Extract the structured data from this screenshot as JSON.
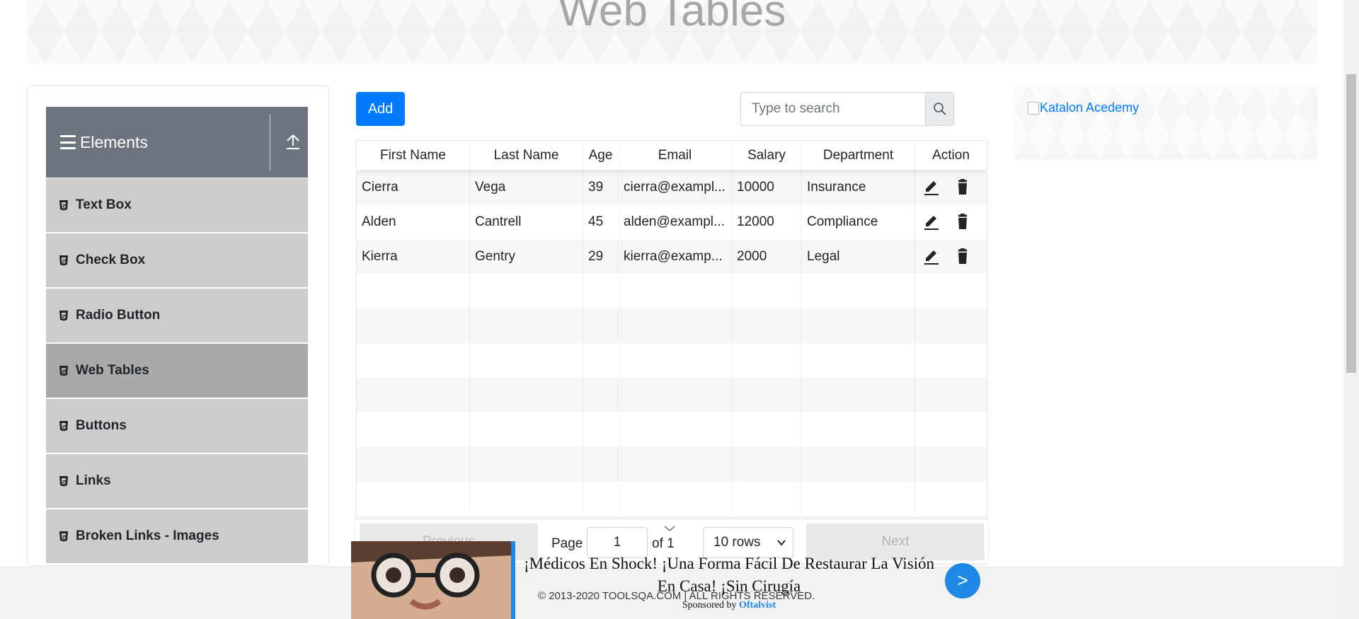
{
  "page": {
    "title": "Web Tables"
  },
  "sidebar": {
    "group_title": "Elements",
    "items": [
      {
        "label": "Text Box",
        "active": false
      },
      {
        "label": "Check Box",
        "active": false
      },
      {
        "label": "Radio Button",
        "active": false
      },
      {
        "label": "Web Tables",
        "active": true
      },
      {
        "label": "Buttons",
        "active": false
      },
      {
        "label": "Links",
        "active": false
      },
      {
        "label": "Broken Links - Images",
        "active": false
      }
    ]
  },
  "toolbar": {
    "add_label": "Add",
    "search_placeholder": "Type to search"
  },
  "table": {
    "columns": [
      "First Name",
      "Last Name",
      "Age",
      "Email",
      "Salary",
      "Department",
      "Action"
    ],
    "rows": [
      {
        "first": "Cierra",
        "last": "Vega",
        "age": "39",
        "email": "cierra@exampl...",
        "salary": "10000",
        "department": "Insurance"
      },
      {
        "first": "Alden",
        "last": "Cantrell",
        "age": "45",
        "email": "alden@exampl...",
        "salary": "12000",
        "department": "Compliance"
      },
      {
        "first": "Kierra",
        "last": "Gentry",
        "age": "29",
        "email": "kierra@examp...",
        "salary": "2000",
        "department": "Legal"
      }
    ]
  },
  "pagination": {
    "previous_label": "Previous",
    "page_label": "Page",
    "page_value": "1",
    "of_label": "of 1",
    "rows_option": "10 rows",
    "next_label": "Next"
  },
  "side_ad": {
    "alt_text": "Katalon Acedemy"
  },
  "footer": {
    "copyright": "© 2013-2020 TOOLSQA.COM | ALL RIGHTS RESERVED."
  },
  "bottom_ad": {
    "headline": "¡Médicos En Shock! ¡Una Forma Fácil De Restaurar La Visión En Casa! ¡Sin Cirugía",
    "sponsor_prefix": "Sponsored by",
    "sponsor_name": "Oftalvist",
    "arrow": ">"
  },
  "colors": {
    "primary": "#007bff",
    "sidebar_header": "#6c757d",
    "menu_item": "#cccccc",
    "menu_item_active": "#a9a9a9",
    "ad_blue": "#1e88e5"
  }
}
